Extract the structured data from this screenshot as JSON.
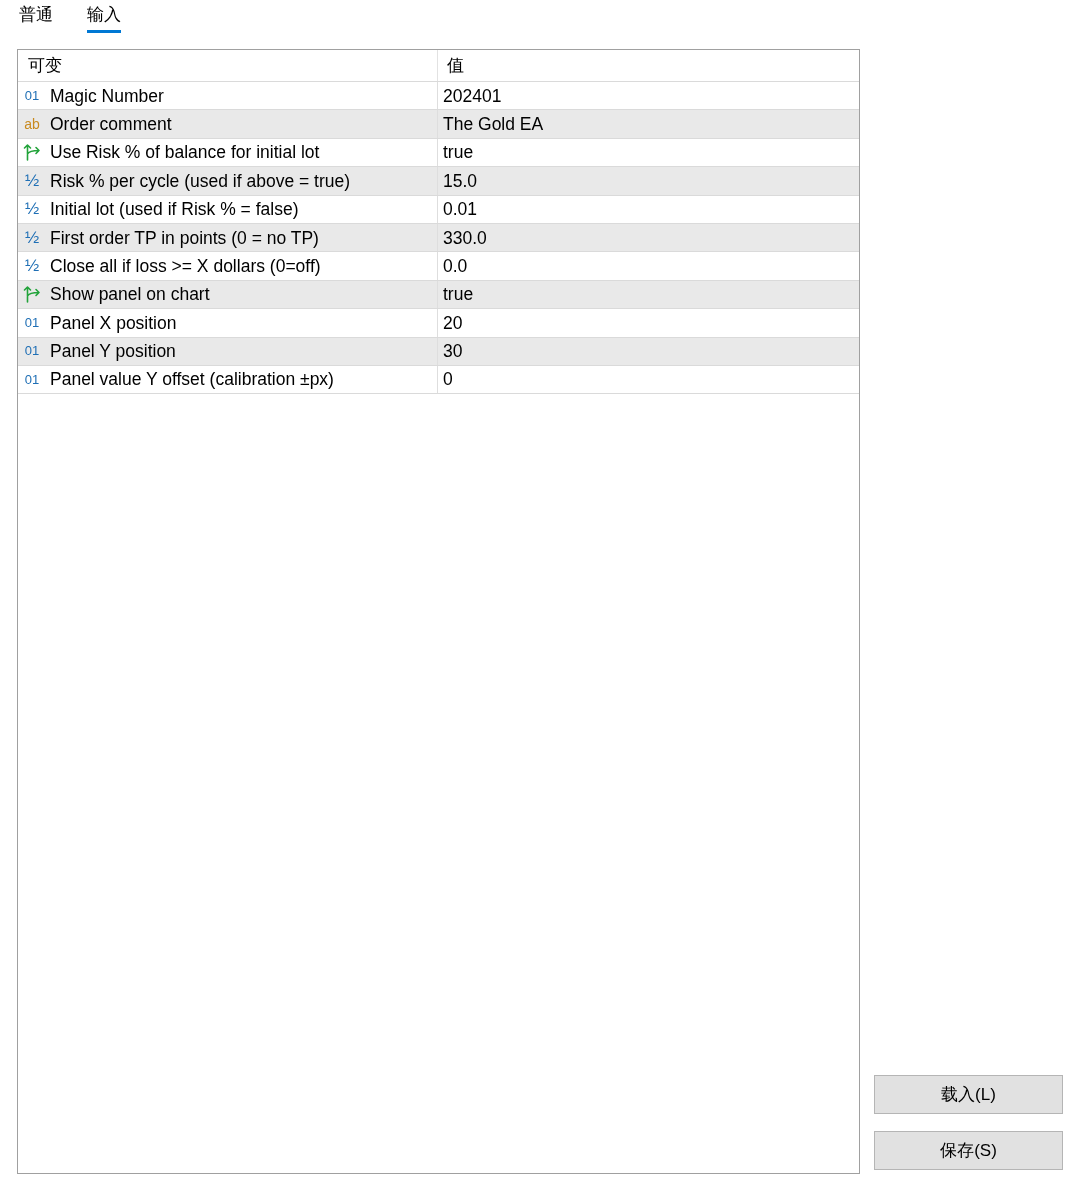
{
  "tabs": [
    {
      "label": "普通",
      "selected": false
    },
    {
      "label": "输入",
      "selected": true
    }
  ],
  "table": {
    "columns": [
      "可变",
      "值"
    ],
    "rows": [
      {
        "kind": "int",
        "icon": "01",
        "variable": "Magic Number",
        "value": "202401"
      },
      {
        "kind": "string",
        "icon": "ab",
        "variable": "Order comment",
        "value": "The Gold EA"
      },
      {
        "kind": "bool",
        "variable": "Use Risk % of balance for initial lot",
        "value": "true"
      },
      {
        "kind": "double",
        "icon": "½",
        "variable": "Risk % per cycle (used if above = true)",
        "value": "15.0"
      },
      {
        "kind": "double",
        "icon": "½",
        "variable": "Initial lot (used if Risk % = false)",
        "value": "0.01"
      },
      {
        "kind": "double",
        "icon": "½",
        "variable": "First order TP in points (0 = no TP)",
        "value": "330.0"
      },
      {
        "kind": "double",
        "icon": "½",
        "variable": "Close all if loss >= X dollars (0=off)",
        "value": "0.0"
      },
      {
        "kind": "bool",
        "variable": "Show panel on chart",
        "value": "true"
      },
      {
        "kind": "int",
        "icon": "01",
        "variable": "Panel X position",
        "value": "20"
      },
      {
        "kind": "int",
        "icon": "01",
        "variable": "Panel Y position",
        "value": "30"
      },
      {
        "kind": "int",
        "icon": "01",
        "variable": "Panel value Y offset (calibration ±px)",
        "value": "0"
      }
    ]
  },
  "buttons": [
    "载入(L)",
    "保存(S)"
  ]
}
